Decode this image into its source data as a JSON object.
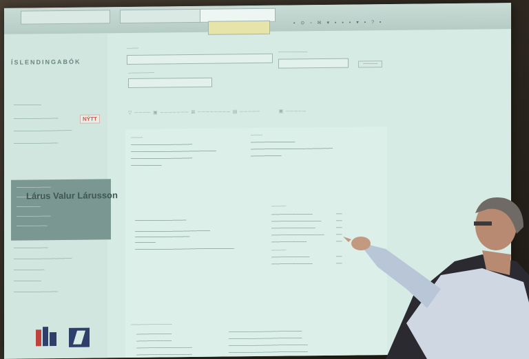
{
  "site": {
    "logo": "ÍSLENDINGABÓK"
  },
  "sidebar": {
    "nytt_badge": "NÝTT"
  },
  "person": {
    "name": "Lárus Valur Lárusson"
  }
}
